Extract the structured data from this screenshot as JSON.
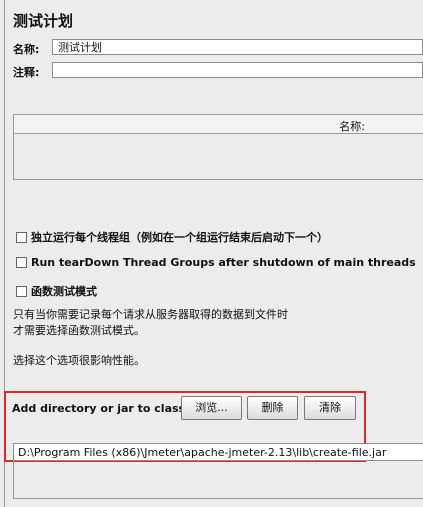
{
  "title": "测试计划",
  "fields": {
    "name_label": "名称:",
    "name_value": "测试计划",
    "comment_label": "注释:",
    "comment_value": ""
  },
  "table": {
    "column_header": "名称:"
  },
  "options": [
    {
      "label": "独立运行每个线程组（例如在一个组运行结束后启动下一个）",
      "checked": false
    },
    {
      "label": "Run tearDown Thread Groups after shutdown of main threads",
      "checked": false
    },
    {
      "label": "函数测试模式",
      "checked": false
    }
  ],
  "notes": {
    "functional_line1": "只有当你需要记录每个请求从服务器取得的数据到文件时",
    "functional_line2": "才需要选择函数测试模式。",
    "perf_warning": "选择这个选项很影响性能。"
  },
  "classpath": {
    "label": "Add directory or jar to classpath",
    "browse_button": "浏览...",
    "delete_button": "删除",
    "clear_button": "清除",
    "path_value": "D:\\Program Files (x86)\\Jmeter\\apache-jmeter-2.13\\lib\\create-file.jar"
  },
  "colors": {
    "highlight": "#e0282f",
    "panel_bg": "#ececec"
  }
}
